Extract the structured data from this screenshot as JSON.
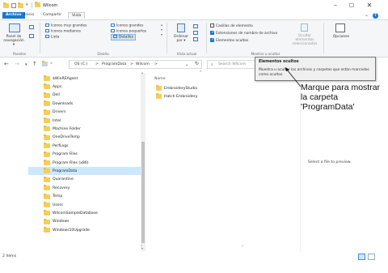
{
  "titlebar": {
    "title": "Wilcom",
    "minimize": "–",
    "maximize": "☐",
    "close": "✕"
  },
  "ribbon_tabs": {
    "file": "Archivo",
    "home": "Inicio",
    "share": "Compartir",
    "view": "Vista",
    "help": "?"
  },
  "ribbon": {
    "panes": {
      "nav_pane": "Panel de\nnavegación ▾",
      "label": "Paneles"
    },
    "layout": {
      "items": [
        "Iconos muy grandes",
        "Iconos grandes",
        "Iconos medianos",
        "Iconos pequeños",
        "Lista",
        "Detalles"
      ],
      "label": "Diseño"
    },
    "current_view": {
      "sort": "Ordenar\npor ▾",
      "label": "Vista actual"
    },
    "show_hide": {
      "item_checkboxes": "Casillas de elemento",
      "extensions": "Extensiones de nombre de archivo",
      "hidden_items": "Elementos ocultos",
      "hide_selected": "Ocultar elementos\nseleccionados",
      "options": "Opciones",
      "label": "Mostrar u ocultar"
    }
  },
  "tooltip": {
    "title": "Elementos ocultos",
    "body": "Muestra u ocultar los archivos y carpetas que están marcados como ocultos."
  },
  "address": {
    "crumbs": [
      "OS (C:)",
      ">",
      "ProgramData",
      ">",
      "Wilcom",
      ">"
    ],
    "search_placeholder": "Search Wilcom"
  },
  "nav_items": [
    "$WinREAgent",
    "Apps",
    "Dell",
    "Downloads",
    "Drivers",
    "Intel",
    "Machine Folder",
    "OneDriveTemp",
    "PerfLogs",
    "Program Files",
    "Program Files (x86)",
    "ProgramData",
    "Quarantine",
    "Recovery",
    "Temp",
    "Users",
    "WilcomSampleDatabase",
    "Windows",
    "Windows10Upgrade"
  ],
  "nav_selected": "ProgramData",
  "content": {
    "column_name": "Name",
    "items": [
      "EmbroideryStudio",
      "Hatch Embroidery"
    ],
    "preview_text": "Select a file to preview."
  },
  "status": {
    "count": "2 items"
  },
  "callout": {
    "text": "Marque para mostrar la carpeta 'ProgramData'"
  },
  "colors": {
    "accent": "#1979ca",
    "selected": "#cce8ff",
    "folder": "#f6cd57"
  }
}
